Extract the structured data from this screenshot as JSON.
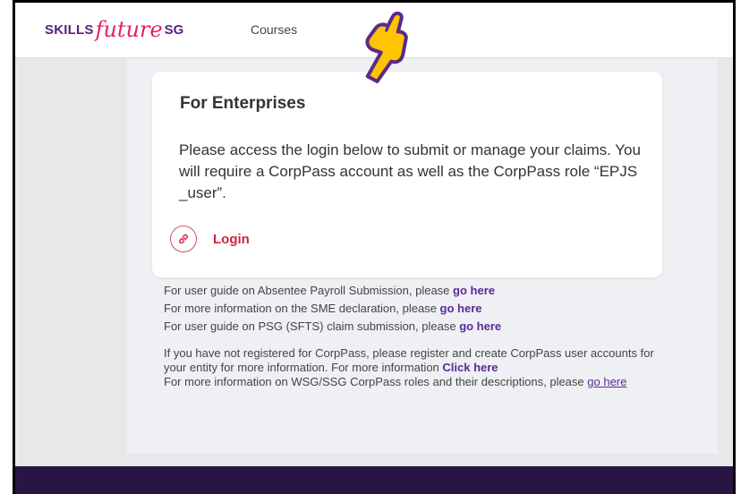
{
  "header": {
    "logo_skills": "SKILLS",
    "logo_future": "future",
    "logo_sg": "SG",
    "nav_courses": "Courses"
  },
  "card": {
    "title": "For Enterprises",
    "body": "Please access the login below to submit or manage your claims. You will require a CorpPass account as well as the CorpPass role “EPJS _user”.",
    "login_label": "Login"
  },
  "links": {
    "line1_text": "For user guide on Absentee Payroll Submission, please ",
    "line1_link": "go here",
    "line2_text": "For more information on the SME declaration, please ",
    "line2_link": "go here",
    "line3_text": "For user guide on PSG (SFTS) claim submission, please ",
    "line3_link": "go here",
    "reg_text": "If you have not registered for CorpPass, please register and create CorpPass user accounts for your entity for more information. For more information ",
    "reg_link": "Click here",
    "roles_text": "For more information on WSG/SSG CorpPass roles and their descriptions, please ",
    "roles_link": "go here"
  },
  "colors": {
    "brand_purple": "#5a1e82",
    "brand_pink": "#e0245e",
    "login_red": "#c9283e",
    "link_purple": "#5b2a9a",
    "footer": "#2a1446",
    "hand_yellow": "#ffc400"
  },
  "icons": [
    "pointing-hand-icon",
    "link-icon"
  ]
}
